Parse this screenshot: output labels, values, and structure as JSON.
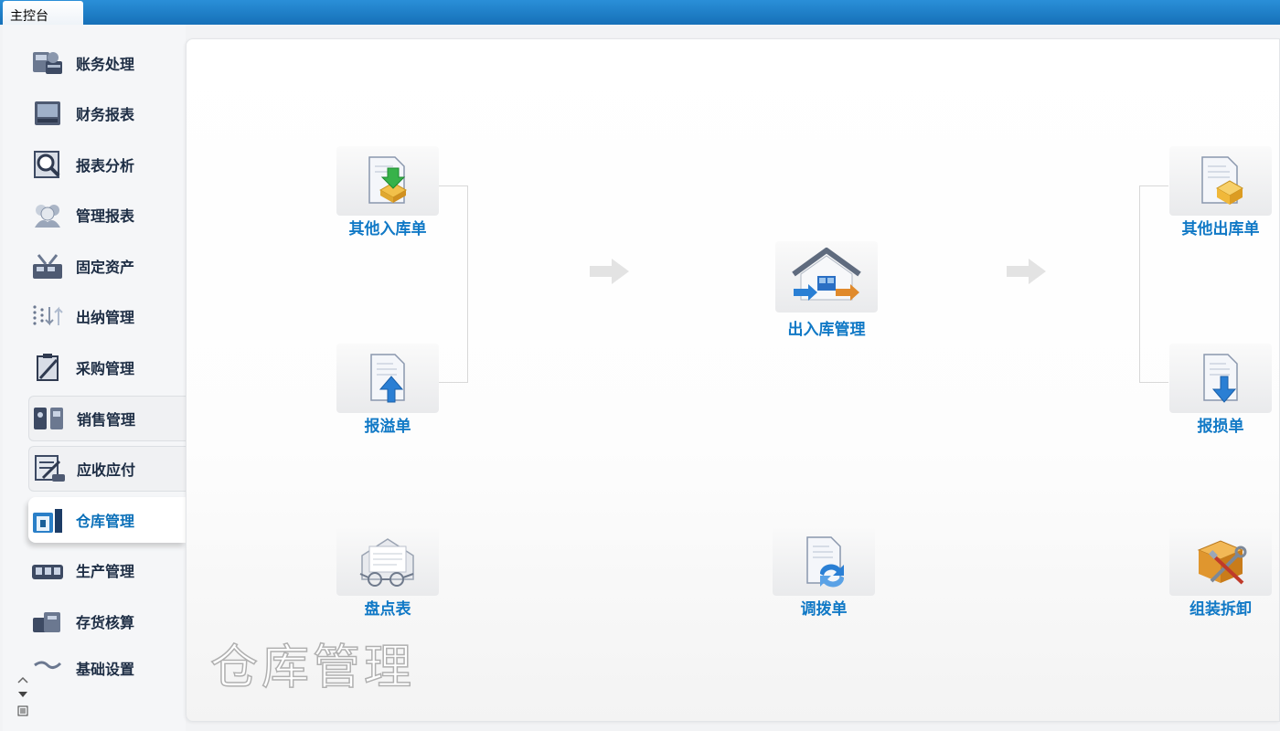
{
  "window": {
    "tab_label": "主控台"
  },
  "sidebar": {
    "items": [
      {
        "label": "账务处理",
        "icon": "accounting-icon"
      },
      {
        "label": "财务报表",
        "icon": "financial-report-icon"
      },
      {
        "label": "报表分析",
        "icon": "report-analysis-icon"
      },
      {
        "label": "管理报表",
        "icon": "management-report-icon"
      },
      {
        "label": "固定资产",
        "icon": "fixed-assets-icon"
      },
      {
        "label": "出纳管理",
        "icon": "cashier-icon"
      },
      {
        "label": "采购管理",
        "icon": "purchase-icon"
      },
      {
        "label": "销售管理",
        "icon": "sales-icon"
      },
      {
        "label": "应收应付",
        "icon": "receivable-payable-icon"
      },
      {
        "label": "仓库管理",
        "icon": "warehouse-icon",
        "active": true
      },
      {
        "label": "生产管理",
        "icon": "production-icon"
      },
      {
        "label": "存货核算",
        "icon": "inventory-accounting-icon"
      },
      {
        "label": "基础设置",
        "icon": "basic-settings-icon"
      }
    ]
  },
  "main": {
    "nodes": {
      "other_in": "其他入库单",
      "overflow": "报溢单",
      "stocktake": "盘点表",
      "inout_mgmt": "出入库管理",
      "transfer": "调拨单",
      "other_out": "其他出库单",
      "loss": "报损单",
      "assembly": "组装拆卸"
    },
    "watermark": "仓库管理"
  },
  "colors": {
    "accent": "#1179c6",
    "topbar": "#1a78c2",
    "sidebar_text": "#1d2d44"
  }
}
